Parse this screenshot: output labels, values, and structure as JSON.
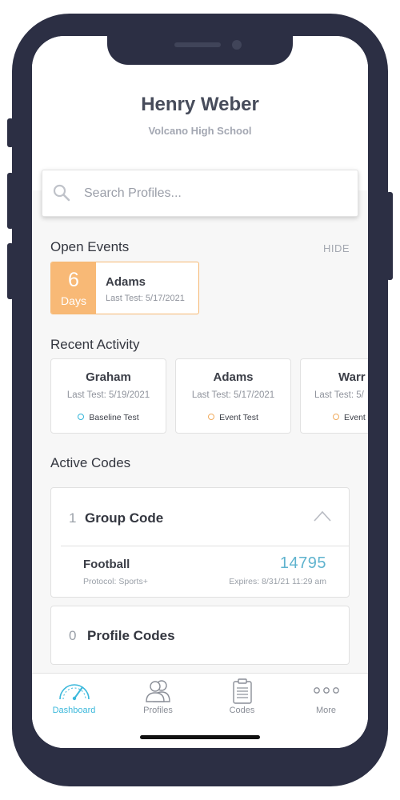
{
  "profile": {
    "name": "Henry Weber",
    "school": "Volcano High School"
  },
  "search": {
    "placeholder": "Search Profiles...",
    "value": ""
  },
  "open_events": {
    "title": "Open Events",
    "hide_label": "HIDE",
    "items": [
      {
        "days": "6",
        "days_label": "Days",
        "name": "Adams",
        "last_test": "Last Test: 5/17/2021"
      }
    ]
  },
  "recent_activity": {
    "title": "Recent Activity",
    "items": [
      {
        "name": "Graham",
        "last_test": "Last Test: 5/19/2021",
        "type": "Baseline Test",
        "status_color": "#33b5d9"
      },
      {
        "name": "Adams",
        "last_test": "Last Test: 5/17/2021",
        "type": "Event Test",
        "status_color": "#f0ab5e"
      },
      {
        "name": "Warr",
        "last_test": "Last Test: 5/",
        "type": "Event",
        "status_color": "#f0ab5e"
      }
    ]
  },
  "active_codes": {
    "title": "Active Codes",
    "group": {
      "count": "1",
      "title": "Group Code",
      "expanded": true,
      "items": [
        {
          "name": "Football",
          "protocol": "Protocol: Sports+",
          "code": "14795",
          "expires": "Expires: 8/31/21 11:29 am"
        }
      ]
    },
    "profile": {
      "count": "0",
      "title": "Profile Codes"
    }
  },
  "tabs": [
    {
      "label": "Dashboard",
      "icon": "speedometer-icon",
      "active": true
    },
    {
      "label": "Profiles",
      "icon": "people-icon",
      "active": false
    },
    {
      "label": "Codes",
      "icon": "clipboard-icon",
      "active": false
    },
    {
      "label": "More",
      "icon": "more-dots-icon",
      "active": false
    }
  ],
  "colors": {
    "accent": "#3bb8db",
    "event_orange": "#f8b976",
    "code_blue": "#5fb3ce",
    "frame": "#2c2f44"
  }
}
